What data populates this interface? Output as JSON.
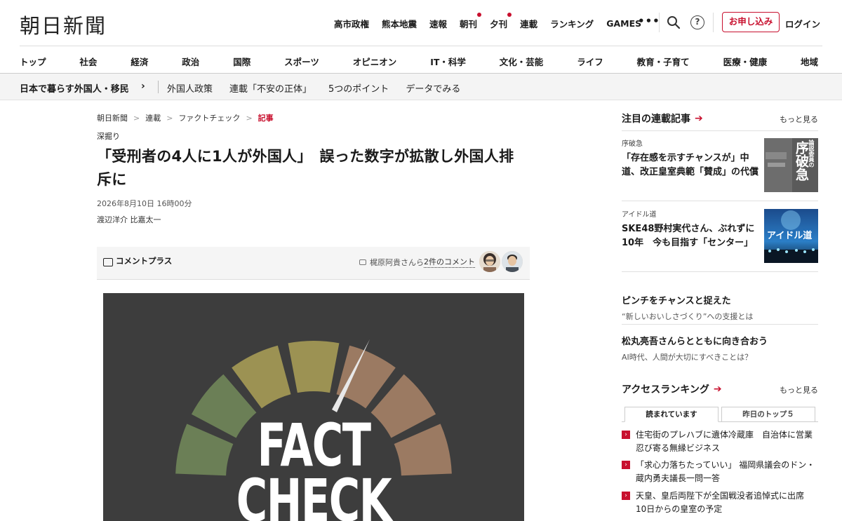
{
  "header": {
    "logo": "朝日新聞",
    "top_nav": [
      "高市政権",
      "熊本地震",
      "速報",
      "朝刊",
      "夕刊",
      "連載",
      "ランキング",
      "GAMES"
    ],
    "more": "•••",
    "help": "?",
    "apply": "お申し込み",
    "login": "ログイン"
  },
  "categories": [
    "トップ",
    "社会",
    "経済",
    "政治",
    "国際",
    "スポーツ",
    "オピニオン",
    "IT・科学",
    "文化・芸能",
    "ライフ",
    "教育・子育て",
    "医療・健康",
    "地域"
  ],
  "subbar": {
    "main": "日本で暮らす外国人・移民",
    "chevron": "›",
    "links": [
      "外国人政策",
      "連載「不安の正体」",
      "5つのポイント",
      "データでみる"
    ]
  },
  "article": {
    "breadcrumb": [
      "朝日新聞",
      "連載",
      "ファクトチェック",
      "記事"
    ],
    "kicker": "深掘り",
    "title": "「受刑者の4人に1人が外国人」　誤った数字が拡散し外国人排斥に",
    "date": "2026年8月10日 16時00分",
    "authors": "渡辺洋介 比嘉太一",
    "comment_label": "コメントプラス",
    "comment_by": "梶原阿貴さんら",
    "comment_count": "2件のコメント",
    "hero_text_1": "FACT",
    "hero_text_2": "CHECK"
  },
  "sidebar": {
    "series_title": "注目の連載記事",
    "more": "もっと見る",
    "series": [
      {
        "cat": "序破急",
        "text": "「存在感を示すチャンスが」中道、改正皇室典範「賛成」の代償",
        "thumb_text": "序破急",
        "thumb_sub": "論説委員の"
      },
      {
        "cat": "アイドル道",
        "text": "SKE48野村実代さん、ぶれずに10年　今も目指す「センター」",
        "thumb_text": "アイドル道"
      }
    ],
    "promos": [
      {
        "title": "ピンチをチャンスと捉えた",
        "sub": "“新しいおいしさづくり”への支援とは"
      },
      {
        "title": "松丸亮吾さんらとともに向き合おう",
        "sub": "AI時代、人間が大切にすべきことは？"
      }
    ],
    "ranking_title": "アクセスランキング",
    "ranking_more": "もっと見る",
    "tabs": [
      "読まれています",
      "昨日のトップ５"
    ],
    "ranking": [
      "住宅街のプレハブに遺体冷蔵庫　自治体に営業　忍び寄る無縁ビジネス",
      "「求心力落ちたっていい」 福岡県議会のドン・蔵内勇夫議長一問一答",
      "天皇、皇后両陛下が全国戦没者追悼式に出席　10日からの皇室の予定"
    ]
  },
  "colors": {
    "accent": "#c8102e",
    "gauge_green": "#6b7f56",
    "gauge_olive": "#9c9253",
    "gauge_brown": "#9b7a62",
    "hero_bg": "#3d3d3d"
  }
}
